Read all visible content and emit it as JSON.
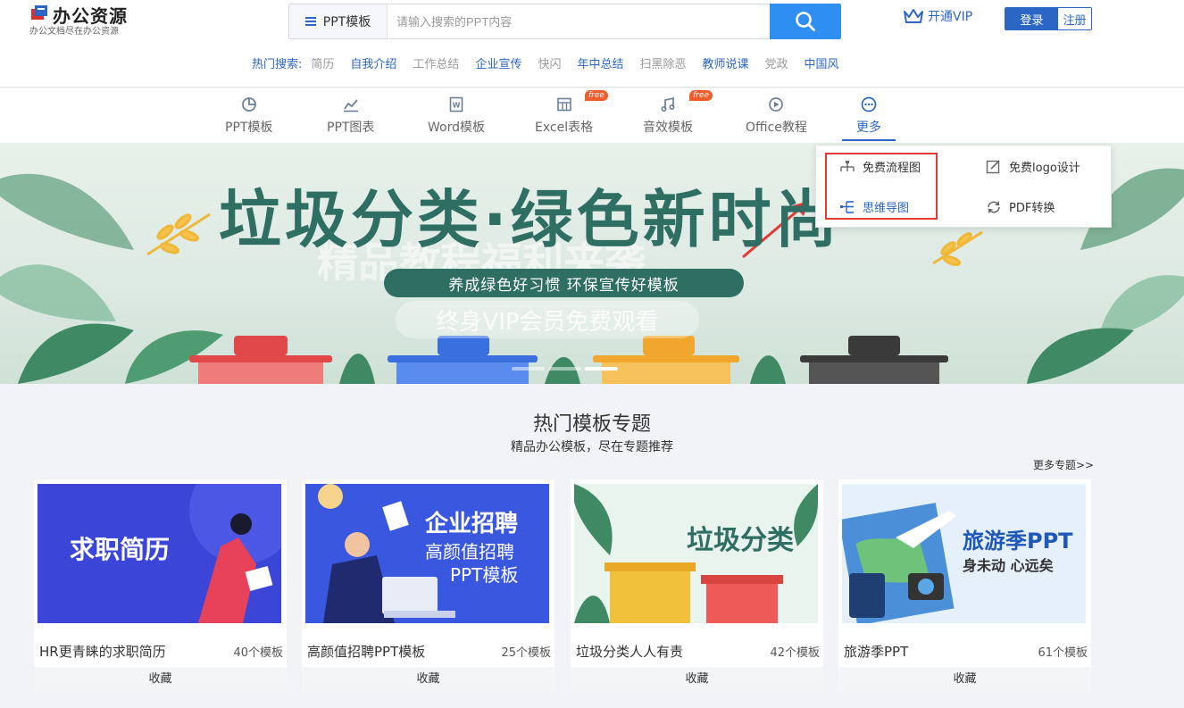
{
  "logo": {
    "title": "办公资源",
    "subtitle": "办公文档尽在办公资源"
  },
  "search": {
    "type_label": "PPT模板",
    "placeholder": "请输入搜索的PPT内容"
  },
  "header": {
    "vip_label": "开通VIP",
    "login_label": "登录",
    "register_label": "注册"
  },
  "hot_search": {
    "label": "热门搜索:",
    "items": [
      {
        "text": "简历",
        "color": "#999999"
      },
      {
        "text": "自我介绍",
        "color": "#2b66c4"
      },
      {
        "text": "工作总结",
        "color": "#999999"
      },
      {
        "text": "企业宣传",
        "color": "#2b66c4"
      },
      {
        "text": "快闪",
        "color": "#999999"
      },
      {
        "text": "年中总结",
        "color": "#2b66c4"
      },
      {
        "text": "扫黑除恶",
        "color": "#999999"
      },
      {
        "text": "教师说课",
        "color": "#2b66c4"
      },
      {
        "text": "党政",
        "color": "#999999"
      },
      {
        "text": "中国风",
        "color": "#2b66c4"
      }
    ]
  },
  "nav": {
    "items": [
      {
        "label": "PPT模板",
        "icon": "pie-chart-icon"
      },
      {
        "label": "PPT图表",
        "icon": "line-chart-icon"
      },
      {
        "label": "Word模板",
        "icon": "word-icon"
      },
      {
        "label": "Excel表格",
        "icon": "table-icon",
        "badge": "free"
      },
      {
        "label": "音效模板",
        "icon": "music-icon",
        "badge": "free"
      },
      {
        "label": "Office教程",
        "icon": "play-icon"
      },
      {
        "label": "更多",
        "icon": "more-icon",
        "active": true
      }
    ]
  },
  "dropdown": {
    "items": [
      {
        "label": "免费流程图",
        "icon": "flowchart-icon"
      },
      {
        "label": "免费logo设计",
        "icon": "edit-icon"
      },
      {
        "label": "思维导图",
        "icon": "mindmap-icon"
      },
      {
        "label": "PDF转换",
        "icon": "refresh-icon"
      }
    ]
  },
  "banner": {
    "title": "垃圾分类·绿色新时尚",
    "ghost_text": "精品教程福利来袭",
    "pill_text": "养成绿色好习惯  环保宣传好模板",
    "vip_text": "终身VIP会员免费观看",
    "dots": 3,
    "active_dot": 3
  },
  "section": {
    "title": "热门模板专题",
    "subtitle": "精品办公模板，尽在专题推荐",
    "more": "更多专题>>"
  },
  "cards": [
    {
      "thumb_text": "求职简历",
      "title": "HR更青睐的求职简历",
      "count": "40个模板",
      "fav": "收藏",
      "bg": "#3b46d9"
    },
    {
      "thumb_text": "企业招聘",
      "thumb_sub1": "高颜值招聘",
      "thumb_sub2": "PPT模板",
      "title": "高颜值招聘PPT模板",
      "count": "25个模板",
      "fav": "收藏",
      "bg": "#3a57e0"
    },
    {
      "thumb_text": "垃圾分类",
      "title": "垃圾分类人人有责",
      "count": "42个模板",
      "fav": "收藏",
      "bg": "#eaf4ee"
    },
    {
      "thumb_text": "旅游季PPT",
      "thumb_sub1": "身未动 心远矣",
      "title": "旅游季PPT",
      "count": "61个模板",
      "fav": "收藏",
      "bg": "#e6f0fb"
    }
  ]
}
